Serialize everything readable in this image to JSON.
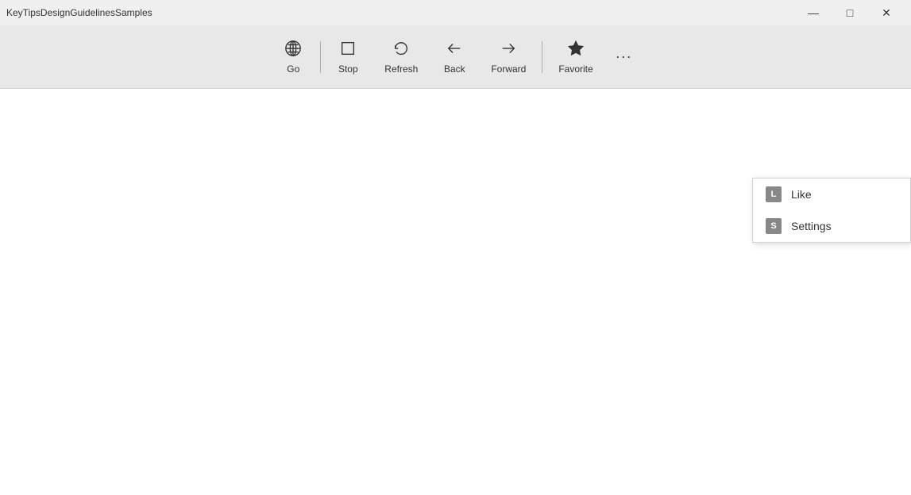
{
  "titleBar": {
    "title": "KeyTipsDesignGuidelinesSamples",
    "controls": {
      "minimize": "—",
      "maximize": "□",
      "close": "✕"
    }
  },
  "toolbar": {
    "buttons": [
      {
        "id": "go",
        "label": "Go",
        "icon": "globe"
      },
      {
        "id": "stop",
        "label": "Stop",
        "icon": "stop"
      },
      {
        "id": "refresh",
        "label": "Refresh",
        "icon": "refresh"
      },
      {
        "id": "back",
        "label": "Back",
        "icon": "back"
      },
      {
        "id": "forward",
        "label": "Forward",
        "icon": "forward"
      },
      {
        "id": "favorite",
        "label": "Favorite",
        "icon": "star"
      }
    ],
    "moreLabel": "···"
  },
  "dropdown": {
    "items": [
      {
        "id": "like",
        "label": "Like",
        "keytip": "L"
      },
      {
        "id": "settings",
        "label": "Settings",
        "keytip": "S"
      }
    ]
  }
}
